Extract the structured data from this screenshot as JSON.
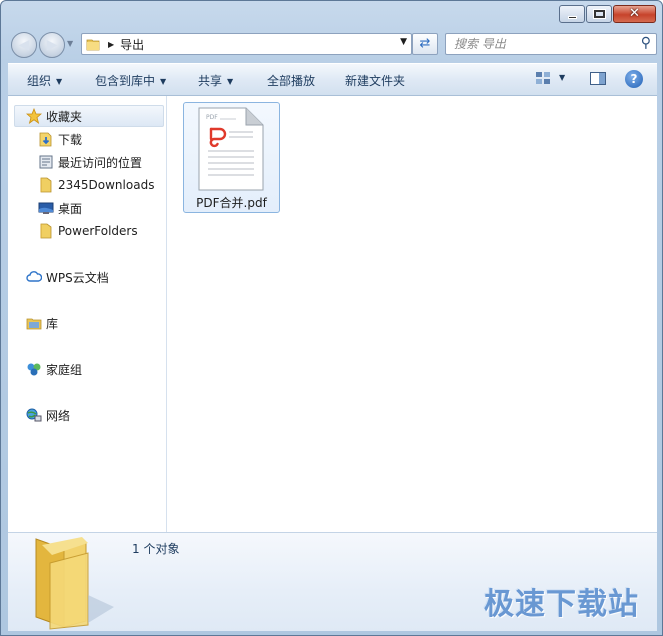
{
  "window": {
    "caption_buttons": [
      "minimize",
      "maximize",
      "close"
    ],
    "close_glyph": "✕"
  },
  "address_bar": {
    "path": [
      "导出"
    ],
    "search_placeholder": "搜索 导出"
  },
  "toolbar": {
    "organize": "组织",
    "include_in_library": "包含到库中",
    "share": "共享",
    "play_all": "全部播放",
    "new_folder": "新建文件夹",
    "help_glyph": "?"
  },
  "nav_pane": {
    "favorites": {
      "label": "收藏夹",
      "items": [
        {
          "label": "下载",
          "icon": "download-folder-icon"
        },
        {
          "label": "最近访问的位置",
          "icon": "recent-places-icon"
        },
        {
          "label": "2345Downloads",
          "icon": "folder-icon"
        },
        {
          "label": "桌面",
          "icon": "desktop-icon"
        },
        {
          "label": "PowerFolders",
          "icon": "folder-icon"
        }
      ]
    },
    "wps_cloud": "WPS云文档",
    "libraries": "库",
    "homegroup": "家庭组",
    "network": "网络"
  },
  "files": [
    {
      "name": "PDF合并.pdf",
      "doc_badge": "PDF",
      "icon": "pdf-file-icon",
      "selected": true
    }
  ],
  "details": {
    "count_text": "1 个对象"
  },
  "watermark": "极速下载站",
  "colors": {
    "selection_border": "#8bb5e0",
    "toolbar_text": "#1e3c5f",
    "pdf_red": "#e0392b",
    "watermark": "#5c8fcf"
  }
}
